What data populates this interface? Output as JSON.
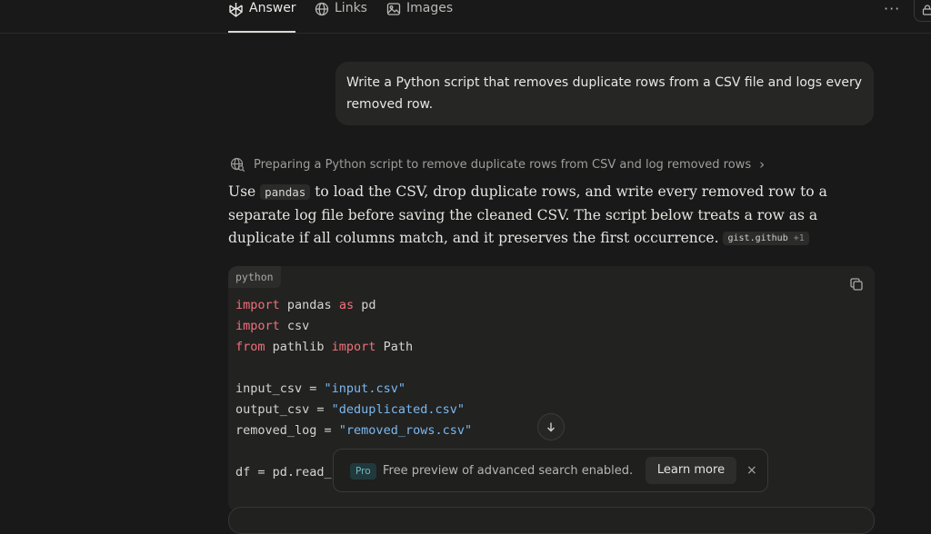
{
  "tabs": [
    {
      "label": "Answer",
      "icon": "perplexity-logo-icon",
      "active": true
    },
    {
      "label": "Links",
      "icon": "globe-icon",
      "active": false
    },
    {
      "label": "Images",
      "icon": "image-icon",
      "active": false
    }
  ],
  "header": {
    "more_label": "···"
  },
  "user_message": "Write a Python script that removes duplicate rows from a CSV file and logs every removed row.",
  "step": {
    "label": "Preparing a Python script to remove duplicate rows from CSV and log removed rows",
    "chevron": "›"
  },
  "answer": {
    "part1": "Use ",
    "inline_code": "pandas",
    "part2": " to load the CSV, drop duplicate rows, and write every removed row to a separate log file before saving the cleaned CSV. The script below treats a row as a duplicate if all columns match, and it preserves the first occurrence.",
    "citation_source": "gist.github",
    "citation_more": "+1"
  },
  "code_block": {
    "language": "python",
    "lines": [
      [
        {
          "t": "import",
          "k": "kw"
        },
        {
          "t": " pandas "
        },
        {
          "t": "as",
          "k": "kw"
        },
        {
          "t": " pd"
        }
      ],
      [
        {
          "t": "import",
          "k": "kw"
        },
        {
          "t": " csv"
        }
      ],
      [
        {
          "t": "from",
          "k": "kw"
        },
        {
          "t": " pathlib "
        },
        {
          "t": "import",
          "k": "kw"
        },
        {
          "t": " Path"
        }
      ],
      [],
      [
        {
          "t": "input_csv = "
        },
        {
          "t": "\"input.csv\"",
          "k": "str"
        }
      ],
      [
        {
          "t": "output_csv = "
        },
        {
          "t": "\"deduplicated.csv\"",
          "k": "str"
        }
      ],
      [
        {
          "t": "removed_log = "
        },
        {
          "t": "\"removed_rows.csv\"",
          "k": "str"
        }
      ],
      [],
      [
        {
          "t": "df = pd.read_"
        }
      ]
    ]
  },
  "toast": {
    "badge": "Pro",
    "message": "Free preview of advanced search enabled.",
    "button": "Learn more",
    "close": "×"
  },
  "colors": {
    "background": "#191919",
    "keyword": "#f2707a",
    "string": "#7ab9f0",
    "pro_badge": "#6fb7bf"
  }
}
